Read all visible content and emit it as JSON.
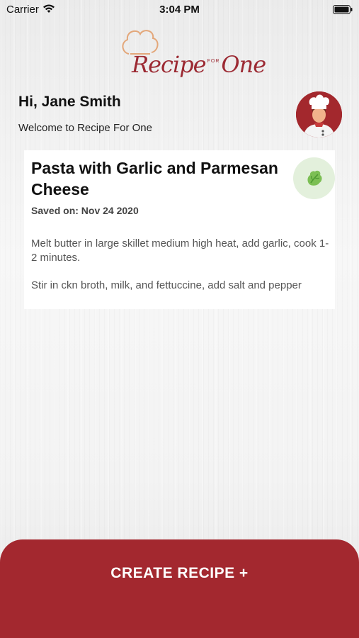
{
  "status_bar": {
    "carrier": "Carrier",
    "time": "3:04 PM"
  },
  "logo": {
    "part1": "Recipe",
    "part2": "FOR",
    "part3": "One"
  },
  "header": {
    "greeting": "Hi, Jane Smith",
    "welcome": "Welcome to Recipe For One"
  },
  "recipe": {
    "title": "Pasta with Garlic and Parmesan Cheese",
    "saved_on": "Saved on: Nov 24 2020",
    "steps": [
      "Melt butter in large skillet medium high heat, add garlic, cook 1-2 minutes.",
      "Stir in ckn broth, milk, and fettuccine, add salt and pepper"
    ],
    "badge_icon": "lettuce-icon"
  },
  "actions": {
    "create_label": "CREATE RECIPE +"
  },
  "colors": {
    "brand": "#a3282f",
    "badge_bg": "#e3f0dc"
  }
}
